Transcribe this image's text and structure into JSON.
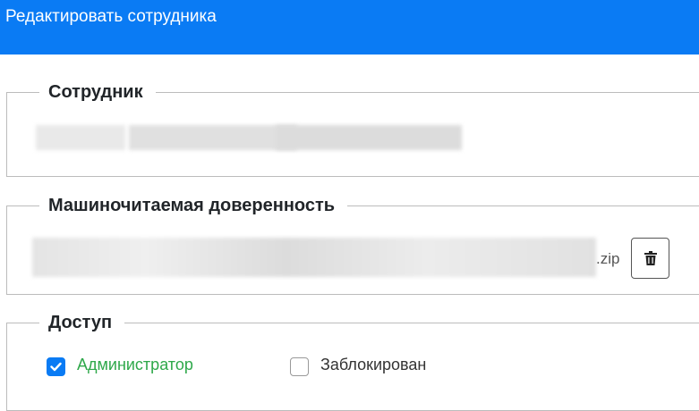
{
  "header": {
    "title": "Редактировать сотрудника",
    "background_color": "#0a7bf4"
  },
  "employee_section": {
    "legend": "Сотрудник",
    "name": ""
  },
  "power_of_attorney_section": {
    "legend": "Машиночитаемая доверенность",
    "file_extension": ".zip",
    "delete_icon": "trash-icon"
  },
  "access_section": {
    "legend": "Доступ",
    "administrator": {
      "label": "Администратор",
      "checked": true,
      "label_color": "#2ea84a"
    },
    "blocked": {
      "label": "Заблокирован",
      "checked": false
    }
  }
}
